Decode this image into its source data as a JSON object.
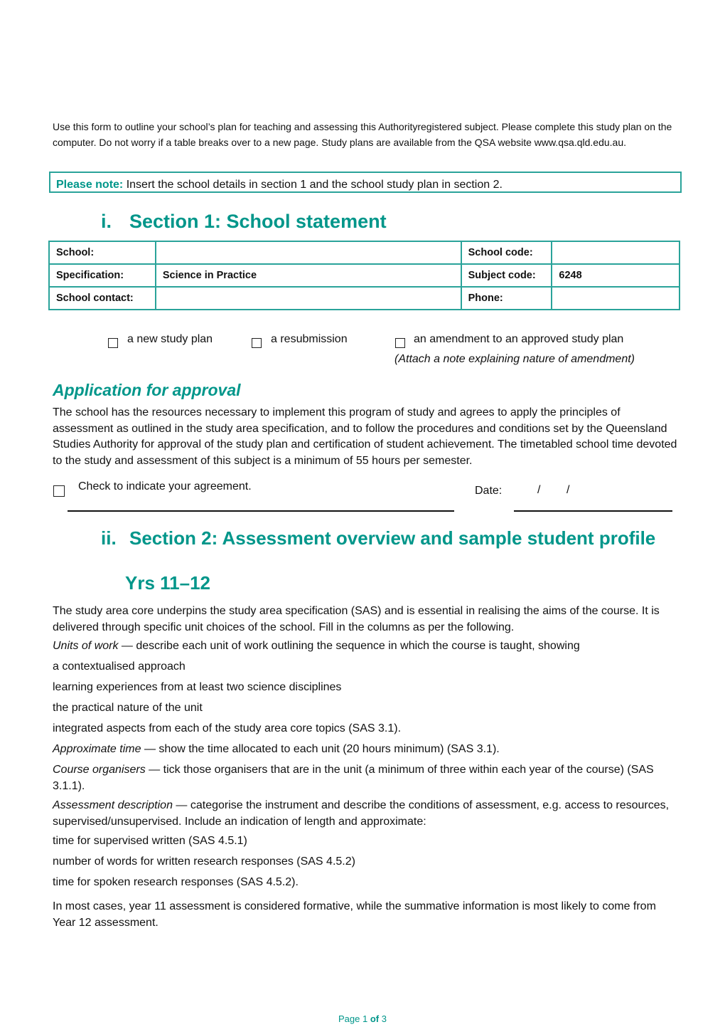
{
  "intro": {
    "text": "Use this form to outline your school’s plan for teaching and assessing this Authorityregistered subject. Please complete this study plan on the computer. Do not worry if a table breaks over to a new page. Study plans are available from the QSA website www.qsa.qld.edu.au."
  },
  "note": {
    "label": "Please note:",
    "text": " Insert the school details in section 1 and the school study plan in section 2."
  },
  "section1": {
    "number": "i.",
    "title": "Section 1: School statement",
    "rows": [
      {
        "label": "School:",
        "value": "",
        "label2": "School code:",
        "value2": ""
      },
      {
        "label": "Specification:",
        "value": "Science in Practice",
        "label2": "Subject code:",
        "value2": "6248"
      },
      {
        "label": "School contact:",
        "value": "",
        "label2": "Phone:",
        "value2": ""
      }
    ]
  },
  "plan_type": {
    "options": [
      {
        "label": "a new study plan",
        "checked": false
      },
      {
        "label": "a resubmission",
        "checked": false
      },
      {
        "label": "an amendment to an approved study plan",
        "checked": false
      }
    ],
    "amendment_note": "(Attach a note explaining nature of amendment)"
  },
  "approval": {
    "title": "Application for approval",
    "text": "The school has the resources necessary to implement this program of study and agrees to apply the principles of assessment as outlined in the study area specification, and to follow the procedures and conditions set by the Queensland Studies Authority for approval of the study plan and certification of student achievement. The timetabled school time devoted to the study and assessment of this subject is a minimum of 55 hours per semester.",
    "agree_label": "Check to indicate your agreement.",
    "agree_checked": false,
    "date_label": "Date:",
    "date_sep1": "/",
    "date_sep2": "/"
  },
  "section2": {
    "number": "ii.",
    "title": "Section 2: Assessment overview and sample student profile",
    "subtitle": "Yrs 11–12",
    "intro": "The study area core underpins the study area specification (SAS) and is essential in realising the aims of the course.  It is delivered through specific unit choices of the school. Fill in the columns as per the following.",
    "units_term": "Units of work",
    "units_text": " — describe each unit of work outlining the sequence in which the course is taught, showing",
    "units_items": [
      "a contextualised approach",
      "learning experiences from at least two science disciplines",
      "the practical nature of the unit",
      "integrated aspects from each of the study area core topics (SAS 3.1)."
    ],
    "time_term": "Approximate time",
    "time_text": " — show the time allocated to each unit (20 hours minimum) (SAS 3.1).",
    "organisers_term": "Course organisers",
    "organisers_text": " — tick those organisers that are in the unit (a minimum of three within each year of the course) (SAS 3.1.1).",
    "assess_term": "Assessment description",
    "assess_text": " — categorise the instrument and describe the conditions of assessment, e.g. access to resources, supervised/unsupervised. Include an indication of length and approximate:",
    "assess_items": [
      "time for supervised written (SAS 4.5.1)",
      "number of words for written research responses (SAS 4.5.2)",
      "time for spoken research responses (SAS 4.5.2)."
    ],
    "closing": "In most cases, year 11 assessment is considered formative, while the summative information is most likely to come from Year 12 assessment."
  },
  "footer": {
    "page_word": "Page ",
    "page": "1",
    "of_word": " of ",
    "total": "3"
  }
}
